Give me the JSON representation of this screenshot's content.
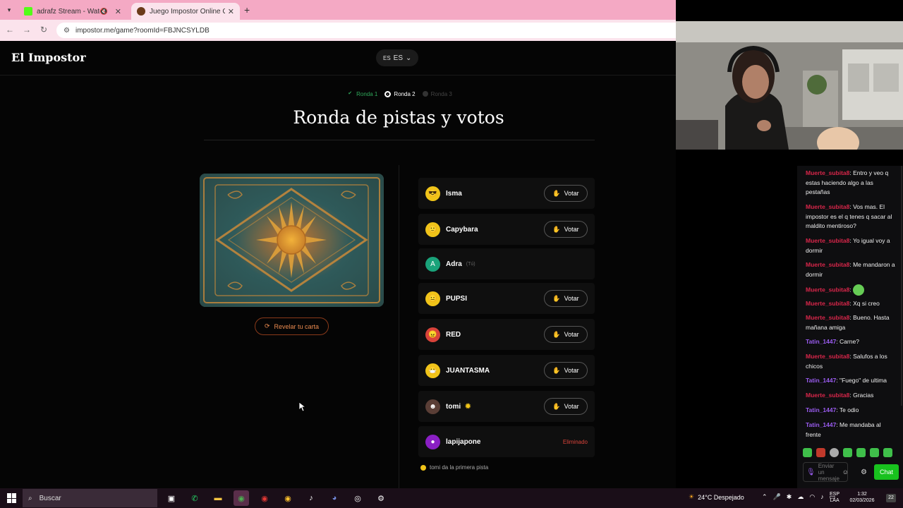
{
  "browser": {
    "tabs": [
      {
        "title": "adrafz Stream - Watch Live",
        "favicon_color": "#53fc18"
      },
      {
        "title": "Juego Impostor Online Gratis",
        "favicon_color": "#6b3b1a"
      }
    ],
    "url": "impostor.me/game?roomId=FBJNCSYLDB"
  },
  "site": {
    "logo": "El Impostor",
    "language": {
      "flag": "ES",
      "code": "ES"
    }
  },
  "rounds": [
    {
      "label": "Ronda 1",
      "state": "done"
    },
    {
      "label": "Ronda 2",
      "state": "current"
    },
    {
      "label": "Ronda 3",
      "state": "future"
    }
  ],
  "title": "Ronda de pistas y votos",
  "reveal_label": "Revelar tu carta",
  "vote_label": "Votar",
  "players": [
    {
      "name": "Isma",
      "avatar_color": "#f0c419",
      "icon": "sunglasses-face-icon",
      "action": "vote"
    },
    {
      "name": "Capybara",
      "avatar_color": "#f0c419",
      "icon": "smile-face-icon",
      "action": "vote"
    },
    {
      "name": "Adra",
      "avatar_color": "#1aa37a",
      "avatar_letter": "A",
      "you": "(Tú)",
      "action": "none"
    },
    {
      "name": "PUPSI",
      "avatar_color": "#f0c419",
      "icon": "neutral-face-icon",
      "action": "vote"
    },
    {
      "name": "RED",
      "avatar_color": "#d9433a",
      "icon": "angry-face-icon",
      "action": "vote"
    },
    {
      "name": "JUANTASMA",
      "avatar_color": "#f0c419",
      "icon": "masked-face-icon",
      "action": "vote"
    },
    {
      "name": "tomi",
      "avatar_color": "#5a3e36",
      "icon": "photo-avatar-icon",
      "action": "vote",
      "marker": "sun"
    },
    {
      "name": "lapijapone",
      "avatar_color": "#8a1fc4",
      "icon": "purple-face-icon",
      "action": "eliminated",
      "status": "Eliminado"
    }
  ],
  "hint": "tomi da la primera pista",
  "chat": {
    "messages": [
      {
        "user": "Muerte_subita8",
        "text": "Entro y veo q estas haciendo algo a las pestañas",
        "color": "#d8264a"
      },
      {
        "user": "Muerte_subita8",
        "text": "Vos mas. El impostor es el q tenes q sacar al maldito mentiroso?",
        "color": "#d8264a"
      },
      {
        "user": "Muerte_subita8",
        "text": "Yo igual voy a dormir",
        "color": "#d8264a"
      },
      {
        "user": "Muerte_subita8",
        "text": "Me mandaron a dormir",
        "color": "#d8264a"
      },
      {
        "user": "Muerte_subita8",
        "text": "",
        "color": "#d8264a",
        "emote": true
      },
      {
        "user": "Muerte_subita8",
        "text": "Xq si creo",
        "color": "#d8264a"
      },
      {
        "user": "Muerte_subita8",
        "text": "Bueno. Hasta mañana amiga",
        "color": "#d8264a"
      },
      {
        "user": "Tatin_1447",
        "text": "Carne?",
        "color": "#9a5cf0"
      },
      {
        "user": "Muerte_subita8",
        "text": "Salufos a los chicos",
        "color": "#d8264a"
      },
      {
        "user": "Tatin_1447",
        "text": "\"Fuego\" de ultima",
        "color": "#9a5cf0"
      },
      {
        "user": "Muerte_subita8",
        "text": "Gracias",
        "color": "#d8264a"
      },
      {
        "user": "Tatin_1447",
        "text": "Te odio",
        "color": "#9a5cf0"
      },
      {
        "user": "Tatin_1447",
        "text": "Me mandaba al frente",
        "color": "#9a5cf0"
      }
    ],
    "input_placeholder": "Enviar un mensaje",
    "send_label": "Chat"
  },
  "taskbar": {
    "search_placeholder": "Buscar",
    "weather": "24°C Despejado",
    "language": "ESP\nLAA",
    "time": "1:32",
    "date": "02/03/2026",
    "notifications": "22"
  }
}
